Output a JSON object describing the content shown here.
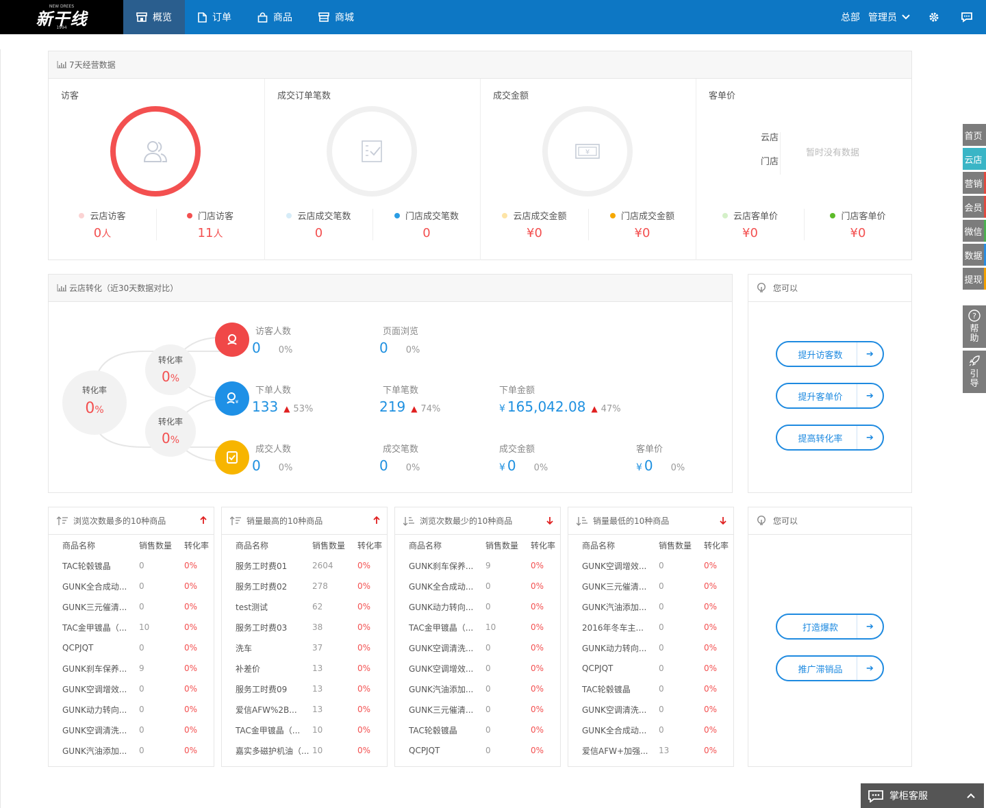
{
  "brand": {
    "name": "新干线",
    "sub": "NEW DREES",
    "year": "1994"
  },
  "nav": [
    {
      "label": "概览",
      "icon": "store-icon"
    },
    {
      "label": "订单",
      "icon": "document-icon"
    },
    {
      "label": "商品",
      "icon": "bag-icon"
    },
    {
      "label": "商城",
      "icon": "shop-icon"
    }
  ],
  "header": {
    "org": "总部",
    "user": "管理员"
  },
  "seven_day": {
    "title": "7天经营数据",
    "cols": [
      {
        "title": "访客",
        "a_label": "云店访客",
        "a_val": "0",
        "a_unit": "人",
        "b_label": "门店访客",
        "b_val": "11",
        "b_unit": "人",
        "a_color": "#fbd3d3",
        "b_color": "#f35050"
      },
      {
        "title": "成交订单笔数",
        "a_label": "云店成交笔数",
        "a_val": "0",
        "b_label": "门店成交笔数",
        "b_val": "0",
        "a_color": "#d6ecf8",
        "b_color": "#2a9de4"
      },
      {
        "title": "成交金额",
        "a_label": "云店成交金额",
        "a_val": "¥0",
        "b_label": "门店成交金额",
        "b_val": "¥0",
        "a_color": "#fde4a6",
        "b_color": "#f6a800"
      },
      {
        "title": "客单价",
        "a_label": "云店客单价",
        "a_val": "¥0",
        "b_label": "门店客单价",
        "b_val": "¥0",
        "a_color": "#d4f0c8",
        "b_color": "#5dbb2a"
      }
    ],
    "aov_rows": [
      "云店",
      "门店"
    ],
    "nodata": "暂时没有数据"
  },
  "conversion": {
    "title": "云店转化（近30天数据对比）",
    "main_label": "转化率",
    "main_val": "0",
    "pct": "%",
    "rate1_label": "转化率",
    "rate1_val": "0",
    "rate2_label": "转化率",
    "rate2_val": "0",
    "visitors": {
      "label": "访客人数",
      "val": "0",
      "pct": "0%"
    },
    "pageviews": {
      "label": "页面浏览",
      "val": "0",
      "pct": "0%"
    },
    "orderers": {
      "label": "下单人数",
      "val": "133",
      "pct": "53%"
    },
    "orders": {
      "label": "下单笔数",
      "val": "219",
      "pct": "74%"
    },
    "order_amount": {
      "label": "下单金额",
      "val": "165,042.08",
      "pct": "47%"
    },
    "buyers": {
      "label": "成交人数",
      "val": "0",
      "pct": "0%"
    },
    "deals": {
      "label": "成交笔数",
      "val": "0",
      "pct": "0%"
    },
    "deal_amount": {
      "label": "成交金额",
      "val": "0",
      "pct": "0%"
    },
    "aov": {
      "label": "客单价",
      "val": "0",
      "pct": "0%"
    },
    "currency": "¥",
    "up_arrow": "▲"
  },
  "suggest1": {
    "title": "您可以",
    "buttons": [
      "提升访客数",
      "提升客单价",
      "提高转化率"
    ]
  },
  "suggest2": {
    "title": "您可以",
    "buttons": [
      "打造爆款",
      "推广滞销品"
    ]
  },
  "list_headers": {
    "name": "商品名称",
    "qty": "销售数量",
    "rate": "转化率"
  },
  "lists": [
    {
      "title": "浏览次数最多的10种商品",
      "dir": "up",
      "rows": [
        [
          "TAC轮毂镀晶",
          "0",
          "0%"
        ],
        [
          "GUNK全合成动...",
          "0",
          "0%"
        ],
        [
          "GUNK三元催清...",
          "0",
          "0%"
        ],
        [
          "TAC金甲镀晶（...",
          "10",
          "0%"
        ],
        [
          "QCPJQT",
          "0",
          "0%"
        ],
        [
          "GUNK刹车保养...",
          "9",
          "0%"
        ],
        [
          "GUNK空调增效...",
          "0",
          "0%"
        ],
        [
          "GUNK动力转向...",
          "0",
          "0%"
        ],
        [
          "GUNK空调清洗...",
          "0",
          "0%"
        ],
        [
          "GUNK汽油添加...",
          "0",
          "0%"
        ]
      ]
    },
    {
      "title": "销量最高的10种商品",
      "dir": "up",
      "rows": [
        [
          "服务工时费01",
          "2604",
          "0%"
        ],
        [
          "服务工时费02",
          "278",
          "0%"
        ],
        [
          "test测试",
          "62",
          "0%"
        ],
        [
          "服务工时费03",
          "38",
          "0%"
        ],
        [
          "洗车",
          "37",
          "0%"
        ],
        [
          "补差价",
          "13",
          "0%"
        ],
        [
          "服务工时费09",
          "13",
          "0%"
        ],
        [
          "爱信AFW%2B...",
          "13",
          "0%"
        ],
        [
          "TAC金甲镀晶（...",
          "10",
          "0%"
        ],
        [
          "嘉实多磁护机油（...",
          "10",
          "0%"
        ]
      ]
    },
    {
      "title": "浏览次数最少的10种商品",
      "dir": "down",
      "rows": [
        [
          "GUNK刹车保养...",
          "9",
          "0%"
        ],
        [
          "GUNK全合成动...",
          "0",
          "0%"
        ],
        [
          "GUNK动力转向...",
          "0",
          "0%"
        ],
        [
          "TAC金甲镀晶（...",
          "10",
          "0%"
        ],
        [
          "GUNK空调清洗...",
          "0",
          "0%"
        ],
        [
          "GUNK空调增效...",
          "0",
          "0%"
        ],
        [
          "GUNK汽油添加...",
          "0",
          "0%"
        ],
        [
          "GUNK三元催清...",
          "0",
          "0%"
        ],
        [
          "TAC轮毂镀晶",
          "0",
          "0%"
        ],
        [
          "QCPJQT",
          "0",
          "0%"
        ]
      ]
    },
    {
      "title": "销量最低的10种商品",
      "dir": "down",
      "rows": [
        [
          "GUNK空调增效...",
          "0",
          "0%"
        ],
        [
          "GUNK三元催清...",
          "0",
          "0%"
        ],
        [
          "GUNK汽油添加...",
          "0",
          "0%"
        ],
        [
          "2016年冬车主...",
          "0",
          "0%"
        ],
        [
          "GUNK动力转向...",
          "0",
          "0%"
        ],
        [
          "QCPJQT",
          "0",
          "0%"
        ],
        [
          "TAC轮毂镀晶",
          "0",
          "0%"
        ],
        [
          "GUNK空调清洗...",
          "0",
          "0%"
        ],
        [
          "GUNK全合成动...",
          "0",
          "0%"
        ],
        [
          "爱信AFW+加强...",
          "13",
          "0%"
        ]
      ]
    }
  ],
  "side_tabs": [
    {
      "label": "首页",
      "color": "#7c7c7c"
    },
    {
      "label": "云店",
      "color": "#3ab5c6"
    },
    {
      "label": "营销",
      "color": "#e04a3f"
    },
    {
      "label": "会员",
      "color": "#e04a3f"
    },
    {
      "label": "微信",
      "color": "#4caf50"
    },
    {
      "label": "数据",
      "color": "#2a8de0"
    },
    {
      "label": "提现",
      "color": "#f3a000"
    }
  ],
  "side_help": {
    "help_line1": "帮",
    "help_line2": "助",
    "guide_line1": "引",
    "guide_line2": "导"
  },
  "service": {
    "label": "掌柜客服"
  }
}
